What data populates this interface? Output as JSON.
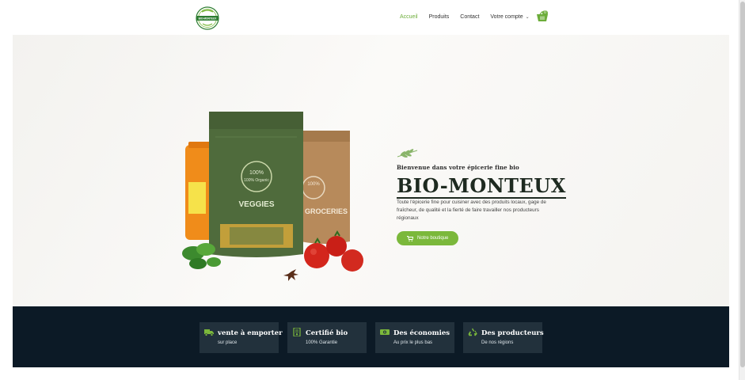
{
  "brand": {
    "logo_text": "BIO-MONTEUX",
    "accent": "#6cad3a"
  },
  "nav": {
    "items": [
      {
        "label": "Accueil",
        "active": true
      },
      {
        "label": "Produits",
        "active": false
      },
      {
        "label": "Contact",
        "active": false
      },
      {
        "label": "Votre compte",
        "active": false
      }
    ],
    "cart_icon": "basket-icon",
    "cart_count": "0"
  },
  "hero": {
    "subtitle": "Bienvenue dans votre épicerie fine bio",
    "title": "BIO-MONTEUX",
    "description": "Toute l'épicerie fine pour cuisiner avec des produits locaux, gage de fraîcheur, de qualité et la fierté de faire travailler nos producteurs régionaux",
    "button_label": "Notre boutique",
    "button_color": "#7bb83b",
    "art": {
      "bag_left_label": "VEGGIES",
      "bag_right_label": "GROCERIES",
      "badge": "100% Organic"
    }
  },
  "features": [
    {
      "icon": "truck-icon",
      "title": "vente à emporter",
      "subtitle": "sur place"
    },
    {
      "icon": "certificate-icon",
      "title": "Certifié bio",
      "subtitle": "100% Garantie"
    },
    {
      "icon": "money-icon",
      "title": "Des économies",
      "subtitle": "Au prix le plus bas"
    },
    {
      "icon": "recycle-icon",
      "title": "Des producteurs",
      "subtitle": "De nos régions"
    }
  ],
  "colors": {
    "band_bg": "#0c1a26",
    "feature_bg": "#22313c",
    "icon_green": "#7bb83b"
  }
}
